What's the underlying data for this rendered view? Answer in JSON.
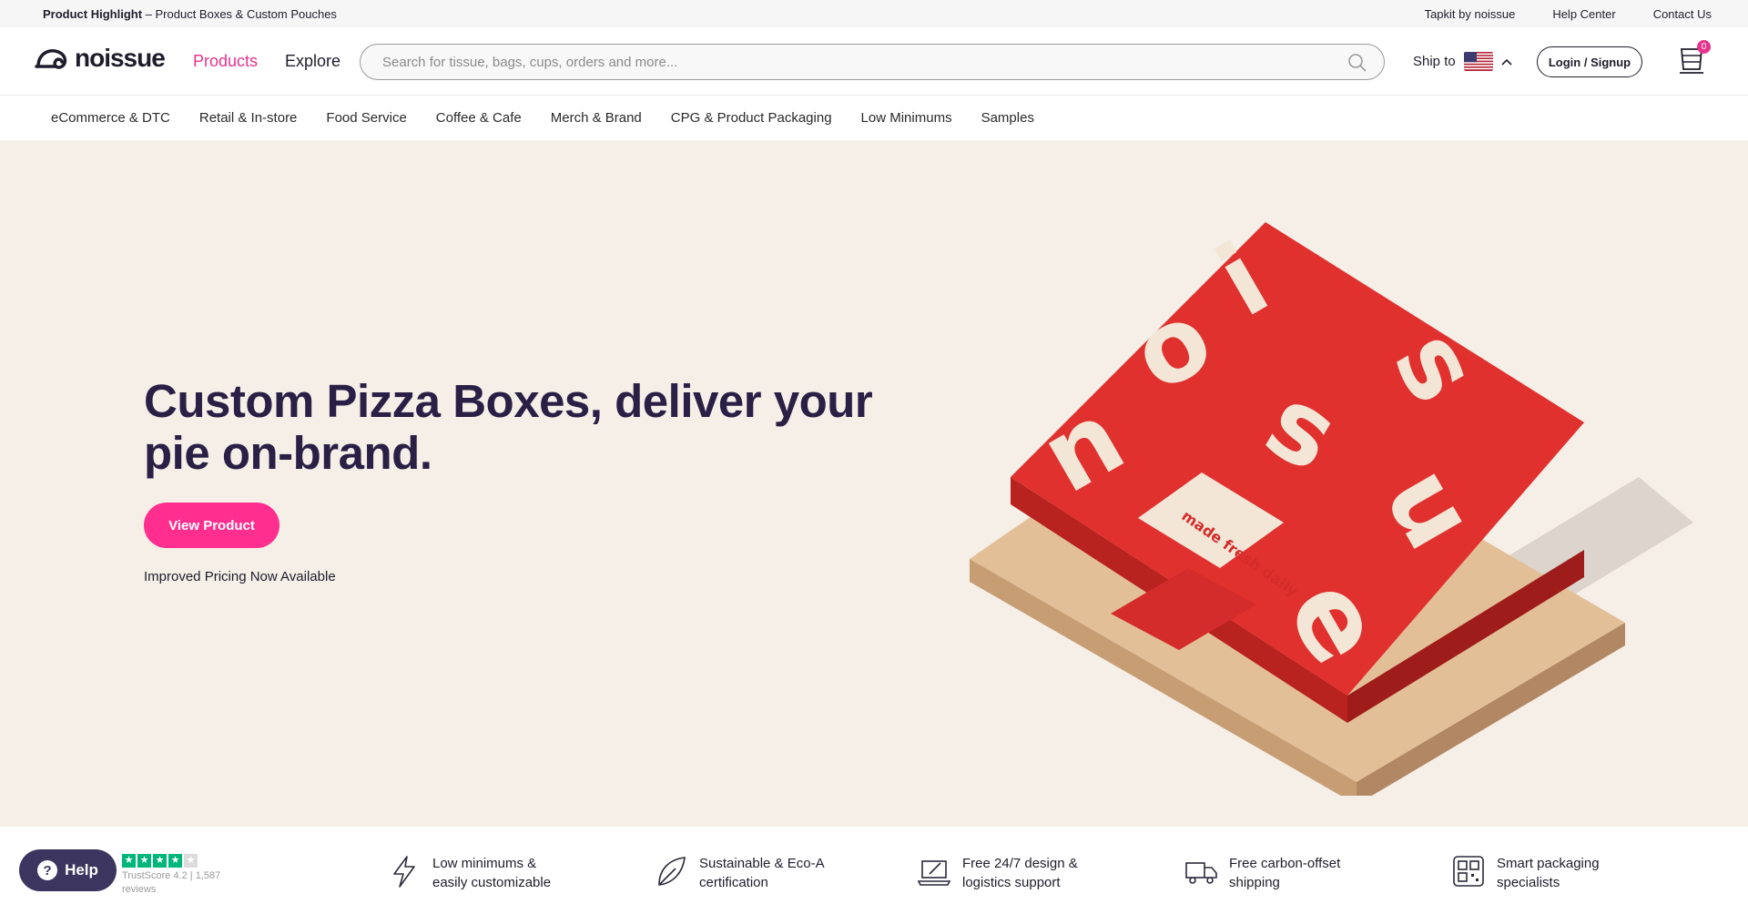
{
  "topbar": {
    "highlight_label": "Product Highlight",
    "highlight_text": " – Product Boxes & Custom Pouches",
    "links": [
      "Tapkit by noissue",
      "Help Center",
      "Contact Us"
    ]
  },
  "header": {
    "logo_text": "noissue",
    "nav": [
      "Products",
      "Explore"
    ],
    "search_placeholder": "Search for tissue, bags, cups, orders and more...",
    "ship_to_label": "Ship to",
    "login_label": "Login / Signup",
    "cart_count": "0"
  },
  "categories": [
    "eCommerce & DTC",
    "Retail & In-store",
    "Food Service",
    "Coffee & Cafe",
    "Merch & Brand",
    "CPG & Product Packaging",
    "Low Minimums",
    "Samples"
  ],
  "hero": {
    "title": "Custom Pizza Boxes, deliver your pie on-brand.",
    "cta_label": "View Product",
    "subtext": "Improved Pricing Now Available",
    "box_letters": [
      "n",
      "o",
      "i",
      "s",
      "s",
      "u",
      "e"
    ],
    "sticker_text": "made fresh daily"
  },
  "features": [
    {
      "icon": "lightning-icon",
      "text": "Low minimums & easily customizable"
    },
    {
      "icon": "leaf-icon",
      "text": "Sustainable & Eco-A certification"
    },
    {
      "icon": "laptop-design-icon",
      "text": "Free 24/7 design & logistics support"
    },
    {
      "icon": "delivery-truck-icon",
      "text": "Free carbon-offset shipping"
    },
    {
      "icon": "qr-code-icon",
      "text": "Smart packaging specialists"
    }
  ],
  "help": {
    "label": "Help"
  },
  "trust": {
    "rating_stars": 4,
    "text": "TrustScore 4.2 | 1,587 reviews"
  },
  "colors": {
    "brand_pink": "#e8338c",
    "cta_pink": "#ff2e8f",
    "hero_bg": "#f5efe8",
    "heading": "#2a1f45",
    "box_red": "#e0312f",
    "trust_green": "#00b67a"
  }
}
